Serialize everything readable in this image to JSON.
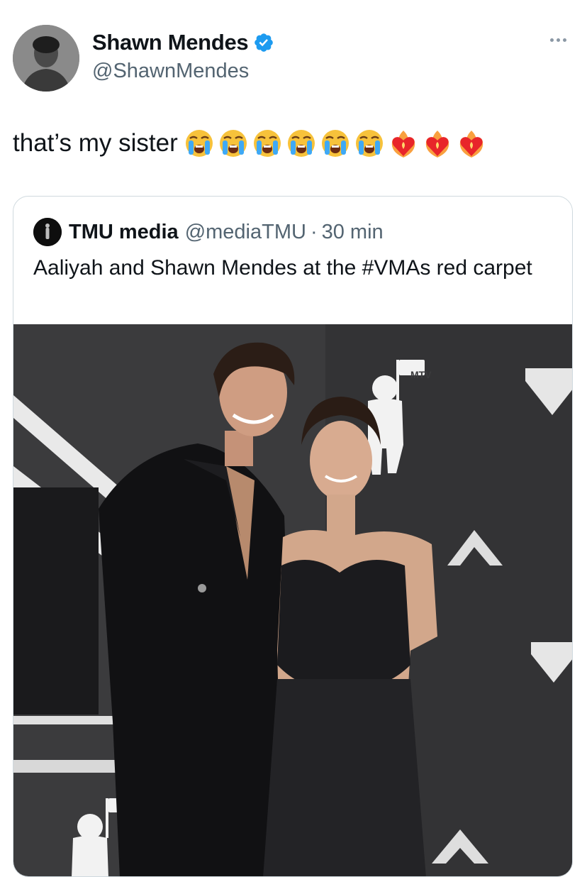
{
  "tweet": {
    "author_name": "Shawn Mendes",
    "author_handle": "@ShawnMendes",
    "text": "that’s my sister",
    "emojis": [
      "loudly-crying-face",
      "loudly-crying-face",
      "loudly-crying-face",
      "loudly-crying-face",
      "loudly-crying-face",
      "loudly-crying-face",
      "heart-on-fire",
      "heart-on-fire",
      "heart-on-fire"
    ]
  },
  "quote": {
    "author_name": "TMU media",
    "author_handle": "@mediaTMU",
    "separator": "·",
    "time": "30 min",
    "text": "Aaliyah and Shawn Mendes at the #VMAs red carpet",
    "media_logo_text": "MTV"
  },
  "colors": {
    "verified": "#1d9bf0",
    "muted": "#536471",
    "border": "#cfd9de",
    "backdrop": "#3a3a3c"
  }
}
